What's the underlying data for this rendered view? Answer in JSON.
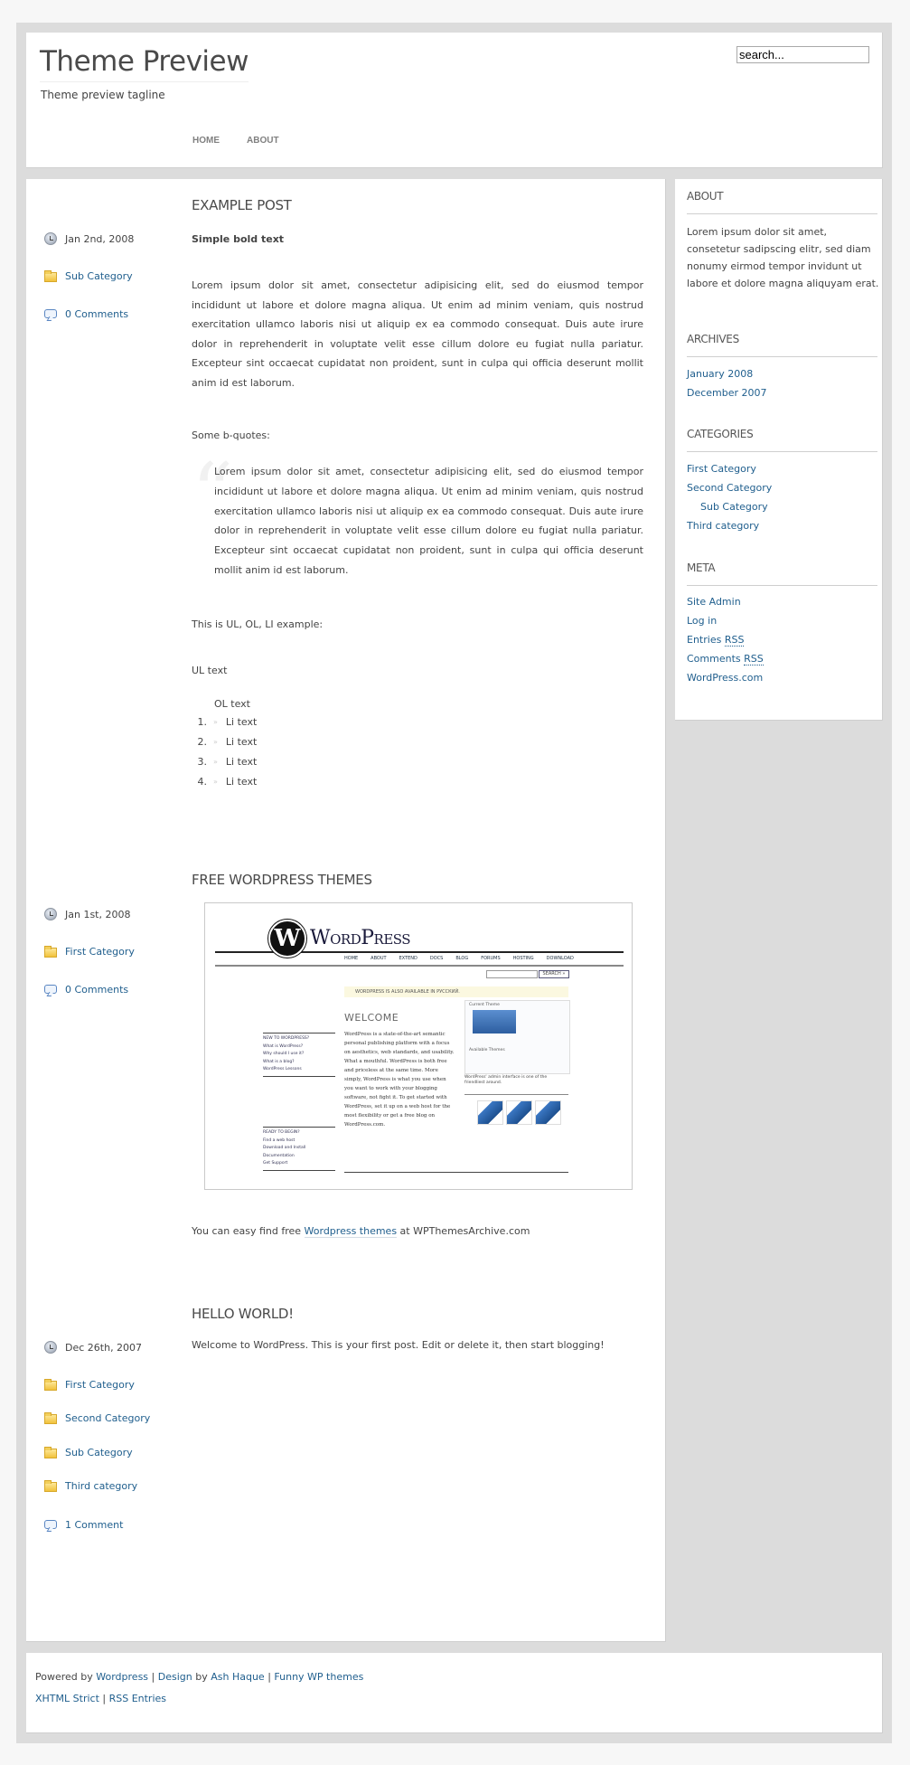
{
  "header": {
    "site_title": "Theme Preview",
    "tagline": "Theme preview tagline",
    "nav": [
      {
        "label": "HOME"
      },
      {
        "label": "ABOUT"
      }
    ],
    "search_value": "search..."
  },
  "posts": [
    {
      "title": "EXAMPLE POST",
      "date": "Jan 2nd, 2008",
      "categories": [
        "Sub Category"
      ],
      "comments": "0 Comments",
      "bold_text": "Simple bold text",
      "paragraph": "Lorem ipsum dolor sit amet, consectetur adipisicing elit, sed do eiusmod tempor incididunt ut labore et dolore magna aliqua. Ut enim ad minim veniam, quis nostrud exercitation ullamco laboris nisi ut aliquip ex ea commodo consequat. Duis aute irure dolor in reprehenderit in voluptate velit esse cillum dolore eu fugiat nulla pariatur. Excepteur sint occaecat cupidatat non proident, sunt in culpa qui officia deserunt mollit anim id est laborum.",
      "bquote_intro": "Some b-quotes:",
      "blockquote": "Lorem ipsum dolor sit amet, consectetur adipisicing elit, sed do eiusmod tempor incididunt ut labore et dolore magna aliqua. Ut enim ad minim veniam, quis nostrud exercitation ullamco laboris nisi ut aliquip ex ea commodo consequat. Duis aute irure dolor in reprehenderit in voluptate velit esse cillum dolore eu fugiat nulla pariatur. Excepteur sint occaecat cupidatat non proident, sunt in culpa qui officia deserunt mollit anim id est laborum.",
      "list_intro": "This is UL, OL, LI example:",
      "ul_text": "UL text",
      "ol_text": "OL text",
      "list_items": [
        {
          "num": "1.",
          "text": "Li text"
        },
        {
          "num": "2.",
          "text": "Li text"
        },
        {
          "num": "3.",
          "text": "Li text"
        },
        {
          "num": "4.",
          "text": "Li text"
        }
      ]
    },
    {
      "title": "FREE WORDPRESS THEMES",
      "date": "Jan 1st, 2008",
      "categories": [
        "First Category"
      ],
      "comments": "0 Comments",
      "screenshot": {
        "wordmark": "WordPress",
        "logo_letter": "W",
        "nav": [
          "HOME",
          "ABOUT",
          "EXTEND",
          "DOCS",
          "BLOG",
          "FORUMS",
          "HOSTING",
          "DOWNLOAD"
        ],
        "search_button": "SEARCH »",
        "notice": "WORDPRESS IS ALSO AVAILABLE IN РУССКИЙ.",
        "welcome": "WELCOME",
        "welcome_text": "WordPress is a state-of-the-art semantic personal publishing platform with a focus on aesthetics, web standards, and usability. What a mouthful. WordPress is both free and priceless at the same time. More simply, WordPress is what you use when you want to work with your blogging software, not fight it. To get started with WordPress, set it up on a web host for the most flexibility or get a free blog on WordPress.com.",
        "new_to_title": "NEW TO WORDPRESS?",
        "new_to_links": [
          "What is WordPress?",
          "Why should I use it?",
          "What is a blog?",
          "WordPress Lessons"
        ],
        "ready_title": "READY TO BEGIN?",
        "ready_links": [
          "Find a web host",
          "Download and Install",
          "Documentation",
          "Get Support"
        ],
        "current_theme": "Current Theme",
        "available_themes": "Available Themes",
        "caption": "WordPress' admin interface is one of the friendliest around."
      },
      "text_before": "You can easy find free ",
      "link_text": "Wordpress themes",
      "text_after": " at WPThemesArchive.com"
    },
    {
      "title": "HELLO WORLD!",
      "date": "Dec 26th, 2007",
      "categories": [
        "First Category",
        "Second Category",
        "Sub Category",
        "Third category"
      ],
      "comments": "1 Comment",
      "paragraph": "Welcome to WordPress. This is your first post. Edit or delete it, then start blogging!"
    }
  ],
  "sidebar": {
    "about": {
      "title": "ABOUT",
      "text": "Lorem ipsum dolor sit amet, consetetur sadipscing elitr, sed diam nonumy eirmod tempor invidunt ut labore et dolore magna aliquyam erat."
    },
    "archives": {
      "title": "ARCHIVES",
      "items": [
        "January 2008",
        "December 2007"
      ]
    },
    "categories": {
      "title": "CATEGORIES",
      "items": [
        {
          "label": "First Category",
          "level": 0
        },
        {
          "label": "Second Category",
          "level": 0
        },
        {
          "label": "Sub Category",
          "level": 1
        },
        {
          "label": "Third category",
          "level": 0
        }
      ]
    },
    "meta": {
      "title": "META",
      "items": [
        {
          "label": "Site Admin"
        },
        {
          "label": "Log in"
        },
        {
          "prefix": "Entries ",
          "abbr": "RSS"
        },
        {
          "prefix": "Comments ",
          "abbr": "RSS"
        },
        {
          "label": "WordPress.com"
        }
      ]
    }
  },
  "footer": {
    "powered_by": "Powered by ",
    "wordpress_link": "Wordpress",
    "sep": " | ",
    "design_link": "Design",
    "by": " by ",
    "author_link": "Ash Haque",
    "funny_link": "Funny WP themes",
    "xhtml_link": "XHTML Strict",
    "rss_link": "RSS Entries"
  },
  "colors": {
    "link": "#1f5e8d",
    "text": "#444444",
    "frame": "#dcdcdc",
    "page_bg": "#f7f7f7"
  }
}
